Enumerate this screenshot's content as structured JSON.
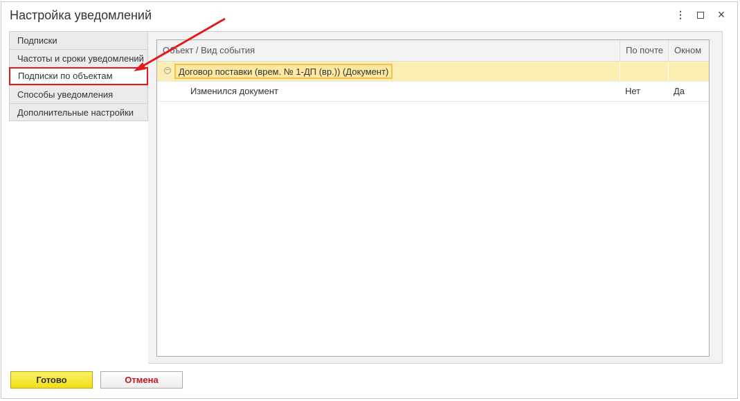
{
  "window": {
    "title": "Настройка уведомлений",
    "more_icon": "⋮",
    "close_icon": "×"
  },
  "tabs": [
    {
      "label": "Подписки",
      "active": false
    },
    {
      "label": "Частоты и сроки уведомлений",
      "active": false
    },
    {
      "label": "Подписки по объектам",
      "active": true
    },
    {
      "label": "Способы уведомления",
      "active": false
    },
    {
      "label": "Дополнительные настройки",
      "active": false
    }
  ],
  "table": {
    "columns": [
      "Объект / Вид события",
      "По почте",
      "Окном"
    ],
    "group_row": {
      "label": "Договор поставки (врем. № 1-ДП (вр.)) (Документ)",
      "collapse_icon": "⊖"
    },
    "rows": [
      {
        "event": "Изменился документ",
        "by_mail": "Нет",
        "by_window": "Да"
      }
    ]
  },
  "buttons": {
    "ok": "Готово",
    "cancel": "Отмена"
  },
  "colors": {
    "accent_yellow": "#f1de14",
    "highlight_red": "#e41818",
    "group_row_bg": "#fbeeb2"
  }
}
